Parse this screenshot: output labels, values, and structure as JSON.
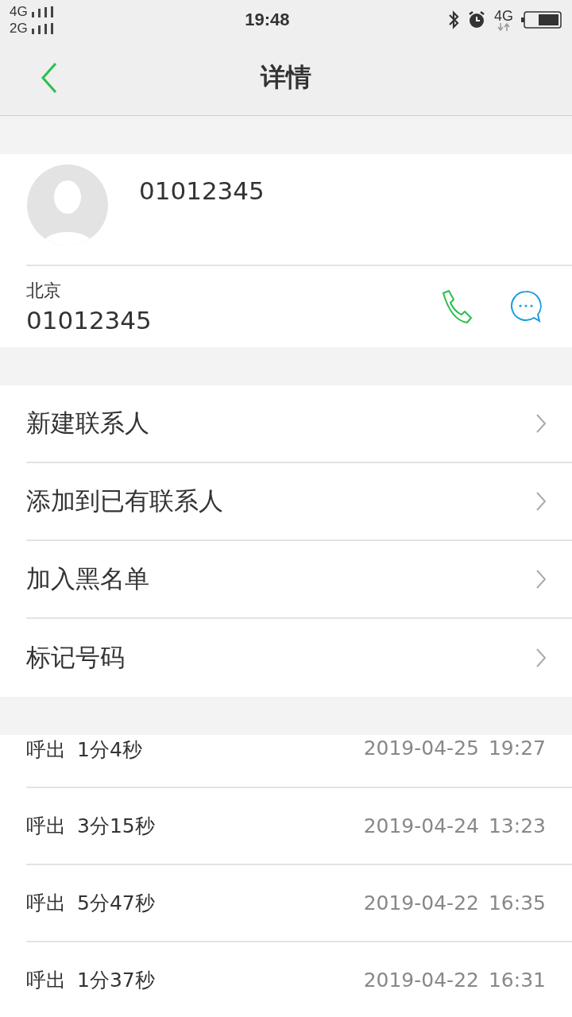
{
  "status_bar": {
    "sim_signals": [
      "4G",
      "2G"
    ],
    "time": "19:48",
    "network": "4G"
  },
  "header": {
    "title": "详情"
  },
  "contact": {
    "name": "01012345",
    "location": "北京",
    "number": "01012345"
  },
  "actions": [
    "新建联系人",
    "添加到已有联系人",
    "加入黑名单",
    "标记号码"
  ],
  "call_log": [
    {
      "type": "呼出",
      "duration": "1分4秒",
      "date": "2019-04-25",
      "time": "19:27"
    },
    {
      "type": "呼出",
      "duration": "3分15秒",
      "date": "2019-04-24",
      "time": "13:23"
    },
    {
      "type": "呼出",
      "duration": "5分47秒",
      "date": "2019-04-22",
      "time": "16:35"
    },
    {
      "type": "呼出",
      "duration": "1分37秒",
      "date": "2019-04-22",
      "time": "16:31"
    }
  ]
}
